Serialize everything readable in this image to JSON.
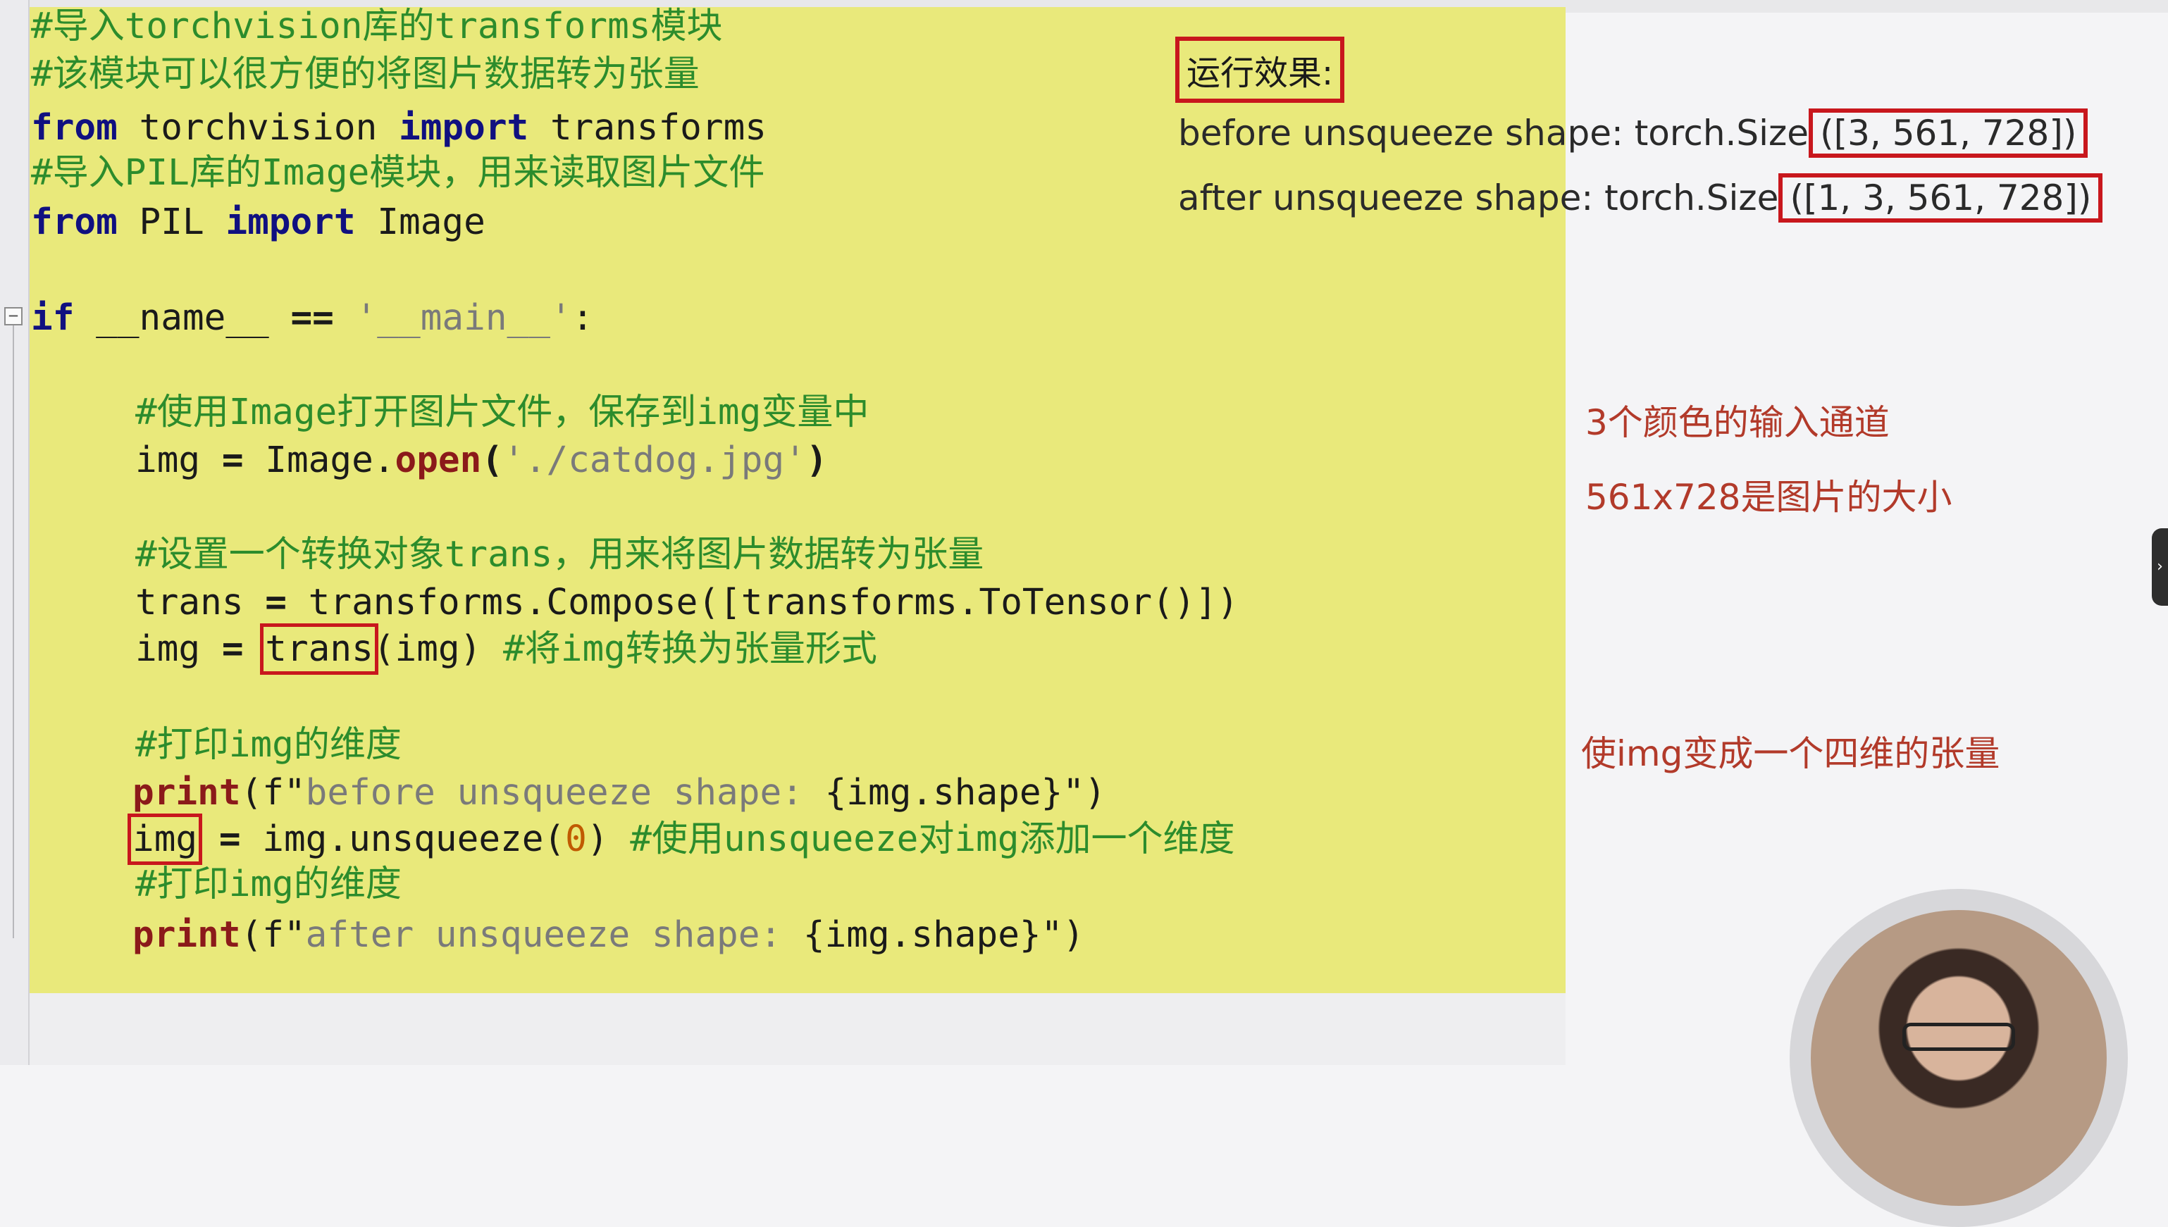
{
  "code": {
    "l1": "#导入torchvision库的transforms模块",
    "l2": "#该模块可以很方便的将图片数据转为张量",
    "l3_kw1": "from",
    "l3_mid": " torchvision ",
    "l3_kw2": "import",
    "l3_end": " transforms",
    "l4": "#导入PIL库的Image模块，用来读取图片文件",
    "l5_kw1": "from",
    "l5_mid": " PIL ",
    "l5_kw2": "import",
    "l5_end": " Image",
    "l6_kw": "if",
    "l6_a": " __name__ ",
    "l6_op": "==",
    "l6_str": " '__main__'",
    "l6_end": ":",
    "l7": "#使用Image打开图片文件，保存到img变量中",
    "l8_a": "img ",
    "l8_op": "=",
    "l8_b": " Image.",
    "l8_fn": "open",
    "l8_p1": "(",
    "l8_str": "'./catdog.jpg'",
    "l8_p2": ")",
    "l9": "#设置一个转换对象trans，用来将图片数据转为张量",
    "l10_a": "trans ",
    "l10_op": "=",
    "l10_b": " transforms.Compose([transforms.ToTensor()])",
    "l11_a": "img ",
    "l11_op": "=",
    "l11_sp": " ",
    "l11_hl": "trans",
    "l11_b": "(img) ",
    "l11_cm": "#将img转换为张量形式",
    "l12": "#打印img的维度",
    "l13_fn": "print",
    "l13_p1": "(f\"",
    "l13_str": "before unsqueeze shape: ",
    "l13_b": "{img.shape}",
    "l13_end": "\")",
    "l14_hl": "img",
    "l14_a": " ",
    "l14_op": "=",
    "l14_b": " img.unsqueeze(",
    "l14_num": "0",
    "l14_c": ") ",
    "l14_cm": "#使用unsqueeze对img添加一个维度",
    "l15": "#打印img的维度",
    "l16_fn": "print",
    "l16_p1": "(f\"",
    "l16_str": "after unsqueeze shape: ",
    "l16_b": "{img.shape}",
    "l16_end": "\")"
  },
  "result": {
    "label": "运行效果:",
    "before_prefix": "before unsqueeze shape: torch.Size",
    "before_value": "([3, 561, 728])",
    "after_prefix": "after unsqueeze shape: torch.Size",
    "after_value": "([1, 3, 561, 728])"
  },
  "notes": {
    "channels": "3个颜色的输入通道",
    "size": "561x728是图片的大小",
    "four_dim": "使img变成一个四维的张量"
  },
  "ui": {
    "fold_glyph": "−",
    "side_handle_glyph": "›"
  },
  "colors": {
    "editor_bg": "#e9e97b",
    "highlight_box": "#c8171d",
    "annotation": "#b23a2a",
    "comment": "#2c8c2c",
    "keyword": "#101080"
  }
}
